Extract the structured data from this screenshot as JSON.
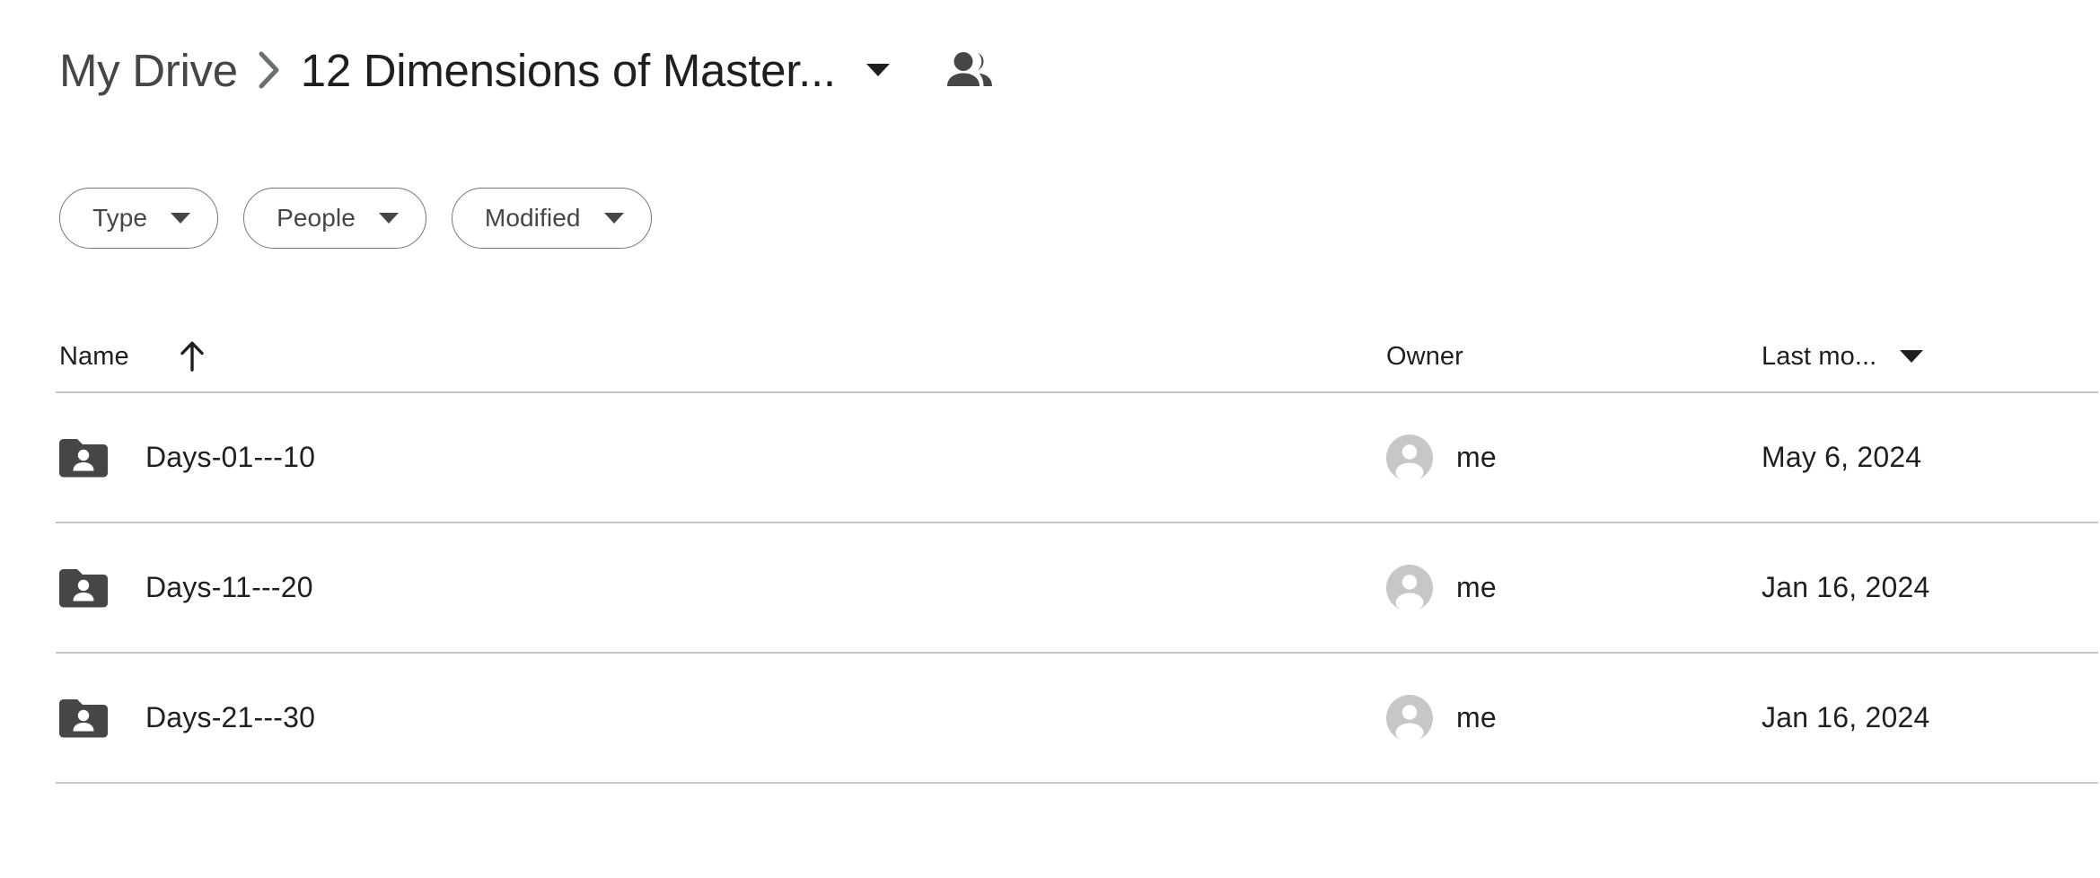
{
  "breadcrumb": {
    "root_label": "My Drive",
    "separator_icon": "chevron-right-icon",
    "current_label": "12 Dimensions of Master...",
    "dropdown_icon": "chevron-down-icon",
    "shared_icon": "people-shared-icon"
  },
  "filters": [
    {
      "label": "Type",
      "caret_icon": "chevron-down-icon"
    },
    {
      "label": "People",
      "caret_icon": "chevron-down-icon"
    },
    {
      "label": "Modified",
      "caret_icon": "chevron-down-icon"
    }
  ],
  "table": {
    "columns": {
      "name": "Name",
      "name_sort_icon": "arrow-up-icon",
      "owner": "Owner",
      "modified": "Last mo...",
      "modified_caret_icon": "chevron-down-icon"
    },
    "rows": [
      {
        "icon": "shared-folder-icon",
        "name": "Days-01---10",
        "owner_avatar": "person-avatar-icon",
        "owner": "me",
        "modified": "May 6, 2024"
      },
      {
        "icon": "shared-folder-icon",
        "name": "Days-11---20",
        "owner_avatar": "person-avatar-icon",
        "owner": "me",
        "modified": "Jan 16, 2024"
      },
      {
        "icon": "shared-folder-icon",
        "name": "Days-21---30",
        "owner_avatar": "person-avatar-icon",
        "owner": "me",
        "modified": "Jan 16, 2024"
      }
    ]
  },
  "colors": {
    "background": "#ffffff",
    "text_primary": "#1f1f1f",
    "text_secondary": "#444746",
    "folder_icon": "#444746",
    "avatar_fill": "#c7c7c7",
    "divider": "#c4c7c5",
    "chip_border": "#747775"
  }
}
